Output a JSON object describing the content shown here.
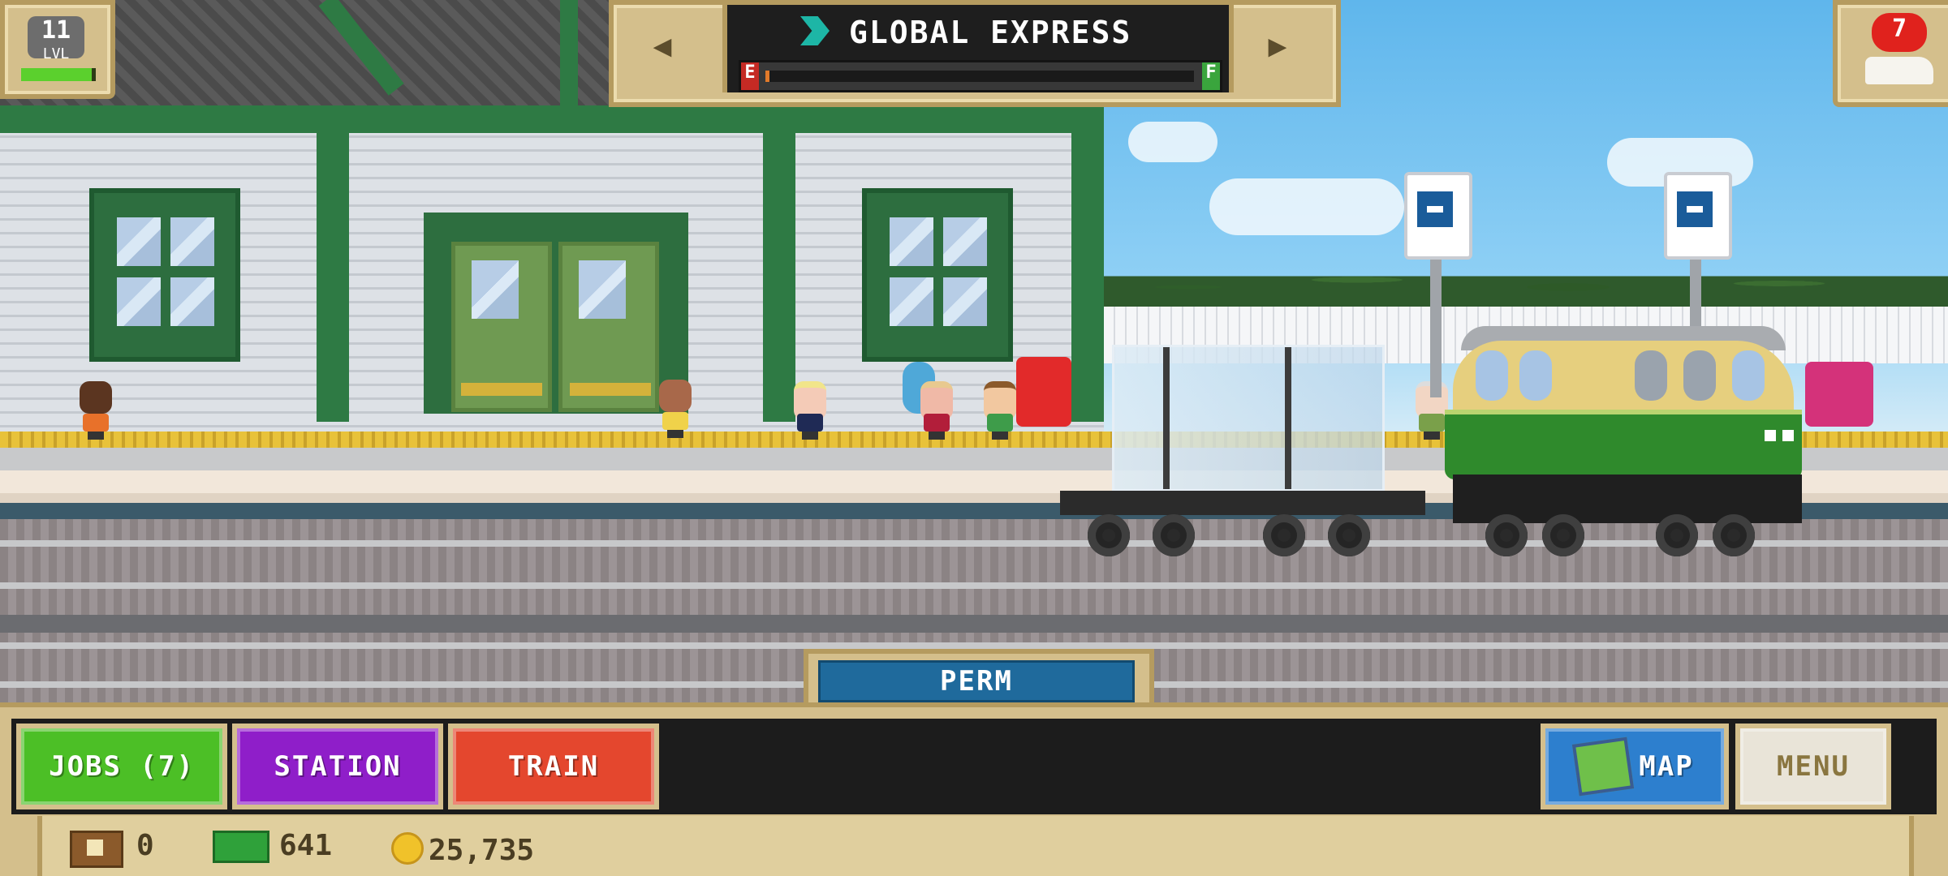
{
  "hud": {
    "level": {
      "number": "11",
      "label": "LVL",
      "xp_progress": 0.95
    },
    "train": {
      "name": "GLOBAL EXPRESS",
      "prev_icon": "left-arrow",
      "next_icon": "right-arrow",
      "fuel": {
        "empty_label": "E",
        "full_label": "F",
        "level": 0.01
      }
    },
    "alerts": {
      "count": "7",
      "icon": "train-icon"
    }
  },
  "station": {
    "name": "PERM"
  },
  "buttons": {
    "jobs": "JOBS (7)",
    "station": "STATION",
    "train": "TRAIN",
    "map": "MAP",
    "menu": "MENU"
  },
  "resources": {
    "crates": "0",
    "cash": "641",
    "coins": "25,735"
  },
  "colors": {
    "jobs": "#4cbf26",
    "station": "#8f1ec9",
    "train": "#e4472e",
    "map": "#2d7fce",
    "menu": "#e9e4d8",
    "station_tab": "#1f6a9c"
  }
}
